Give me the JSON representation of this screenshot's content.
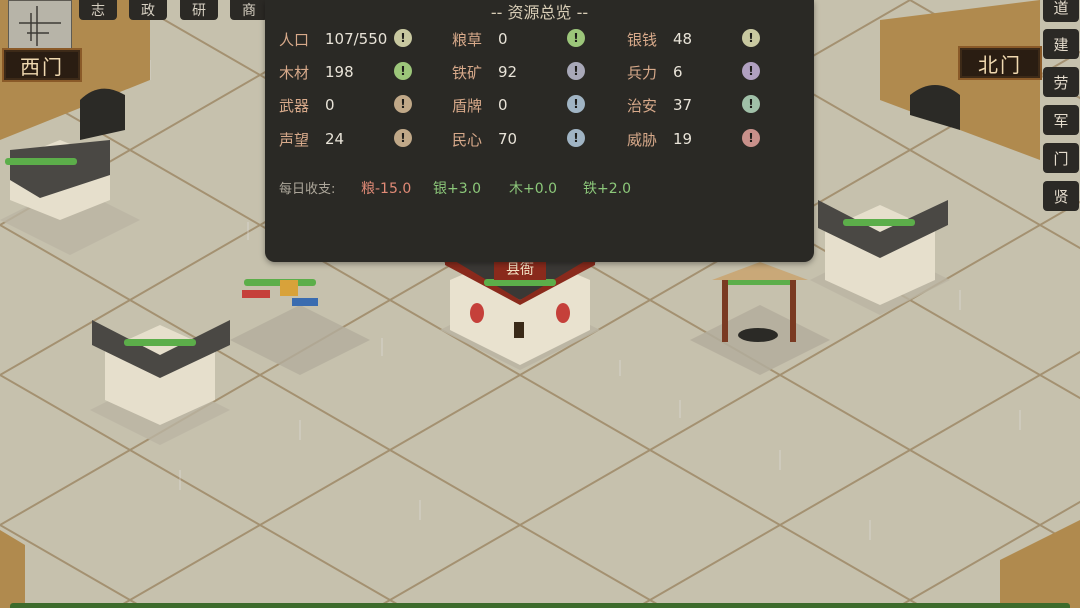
{
  "nav_tabs": [
    "志",
    "政",
    "研",
    "商"
  ],
  "side_menu": [
    "道",
    "建",
    "劳",
    "军",
    "门",
    "贤"
  ],
  "map": {
    "west_gate": "西门",
    "north_gate": "北门",
    "county_hall": "县衙"
  },
  "panel": {
    "title": "-- 资源总览 --",
    "resources": [
      {
        "label": "人口",
        "value": "107/550",
        "alert_color": "#c8c8a0"
      },
      {
        "label": "粮草",
        "value": "0",
        "alert_color": "#9cc67a"
      },
      {
        "label": "银钱",
        "value": "48",
        "alert_color": "#c8c8a0"
      },
      {
        "label": "木材",
        "value": "198",
        "alert_color": "#9cc67a"
      },
      {
        "label": "铁矿",
        "value": "92",
        "alert_color": "#a8a8b8"
      },
      {
        "label": "兵力",
        "value": "6",
        "alert_color": "#b0a0c0"
      },
      {
        "label": "武器",
        "value": "0",
        "alert_color": "#c0a888"
      },
      {
        "label": "盾牌",
        "value": "0",
        "alert_color": "#a0b4c4"
      },
      {
        "label": "治安",
        "value": "37",
        "alert_color": "#a0c0a8"
      },
      {
        "label": "声望",
        "value": "24",
        "alert_color": "#c0a888"
      },
      {
        "label": "民心",
        "value": "70",
        "alert_color": "#a0b4c4"
      },
      {
        "label": "威胁",
        "value": "19",
        "alert_color": "#c8908a"
      }
    ],
    "alert_glyph": "!",
    "daily_label": "每日收支:",
    "daily": [
      {
        "text": "粮-15.0",
        "color": "#e08a76"
      },
      {
        "text": "银+3.0",
        "color": "#8cc87a"
      },
      {
        "text": "木+0.0",
        "color": "#8cc87a"
      },
      {
        "text": "铁+2.0",
        "color": "#8cc87a"
      }
    ]
  }
}
